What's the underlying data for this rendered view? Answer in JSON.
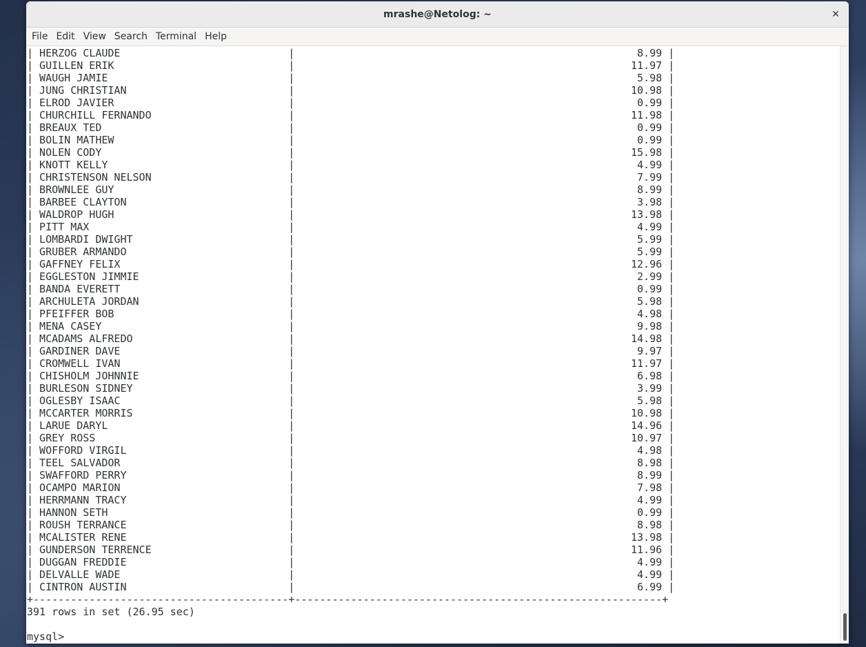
{
  "window": {
    "title": "mrashe@Netolog: ~",
    "close_glyph": "✕"
  },
  "menu": [
    "File",
    "Edit",
    "View",
    "Search",
    "Terminal",
    "Help"
  ],
  "table": {
    "rows": [
      {
        "name": "HERZOG CLAUDE",
        "amount": "8.99"
      },
      {
        "name": "GUILLEN ERIK",
        "amount": "11.97"
      },
      {
        "name": "WAUGH JAMIE",
        "amount": "5.98"
      },
      {
        "name": "JUNG CHRISTIAN",
        "amount": "10.98"
      },
      {
        "name": "ELROD JAVIER",
        "amount": "0.99"
      },
      {
        "name": "CHURCHILL FERNANDO",
        "amount": "11.98"
      },
      {
        "name": "BREAUX TED",
        "amount": "0.99"
      },
      {
        "name": "BOLIN MATHEW",
        "amount": "0.99"
      },
      {
        "name": "NOLEN CODY",
        "amount": "15.98"
      },
      {
        "name": "KNOTT KELLY",
        "amount": "4.99"
      },
      {
        "name": "CHRISTENSON NELSON",
        "amount": "7.99"
      },
      {
        "name": "BROWNLEE GUY",
        "amount": "8.99"
      },
      {
        "name": "BARBEE CLAYTON",
        "amount": "3.98"
      },
      {
        "name": "WALDROP HUGH",
        "amount": "13.98"
      },
      {
        "name": "PITT MAX",
        "amount": "4.99"
      },
      {
        "name": "LOMBARDI DWIGHT",
        "amount": "5.99"
      },
      {
        "name": "GRUBER ARMANDO",
        "amount": "5.99"
      },
      {
        "name": "GAFFNEY FELIX",
        "amount": "12.96"
      },
      {
        "name": "EGGLESTON JIMMIE",
        "amount": "2.99"
      },
      {
        "name": "BANDA EVERETT",
        "amount": "0.99"
      },
      {
        "name": "ARCHULETA JORDAN",
        "amount": "5.98"
      },
      {
        "name": "PFEIFFER BOB",
        "amount": "4.98"
      },
      {
        "name": "MENA CASEY",
        "amount": "9.98"
      },
      {
        "name": "MCADAMS ALFREDO",
        "amount": "14.98"
      },
      {
        "name": "GARDINER DAVE",
        "amount": "9.97"
      },
      {
        "name": "CROMWELL IVAN",
        "amount": "11.97"
      },
      {
        "name": "CHISHOLM JOHNNIE",
        "amount": "6.98"
      },
      {
        "name": "BURLESON SIDNEY",
        "amount": "3.99"
      },
      {
        "name": "OGLESBY ISAAC",
        "amount": "5.98"
      },
      {
        "name": "MCCARTER MORRIS",
        "amount": "10.98"
      },
      {
        "name": "LARUE DARYL",
        "amount": "14.96"
      },
      {
        "name": "GREY ROSS",
        "amount": "10.97"
      },
      {
        "name": "WOFFORD VIRGIL",
        "amount": "4.98"
      },
      {
        "name": "TEEL SALVADOR",
        "amount": "8.98"
      },
      {
        "name": "SWAFFORD PERRY",
        "amount": "8.99"
      },
      {
        "name": "OCAMPO MARION",
        "amount": "7.98"
      },
      {
        "name": "HERRMANN TRACY",
        "amount": "4.99"
      },
      {
        "name": "HANNON SETH",
        "amount": "0.99"
      },
      {
        "name": "ROUSH TERRANCE",
        "amount": "8.98"
      },
      {
        "name": "MCALISTER RENE",
        "amount": "13.98"
      },
      {
        "name": "GUNDERSON TERRENCE",
        "amount": "11.96"
      },
      {
        "name": "DUGGAN FREDDIE",
        "amount": "4.99"
      },
      {
        "name": "DELVALLE WADE",
        "amount": "4.99"
      },
      {
        "name": "CINTRON AUSTIN",
        "amount": "6.99"
      }
    ],
    "border_line": "+-----------------------------------------+-----------------------------------------------------------+"
  },
  "status_line": "391 rows in set (26.95 sec)",
  "prompt": "mysql> "
}
